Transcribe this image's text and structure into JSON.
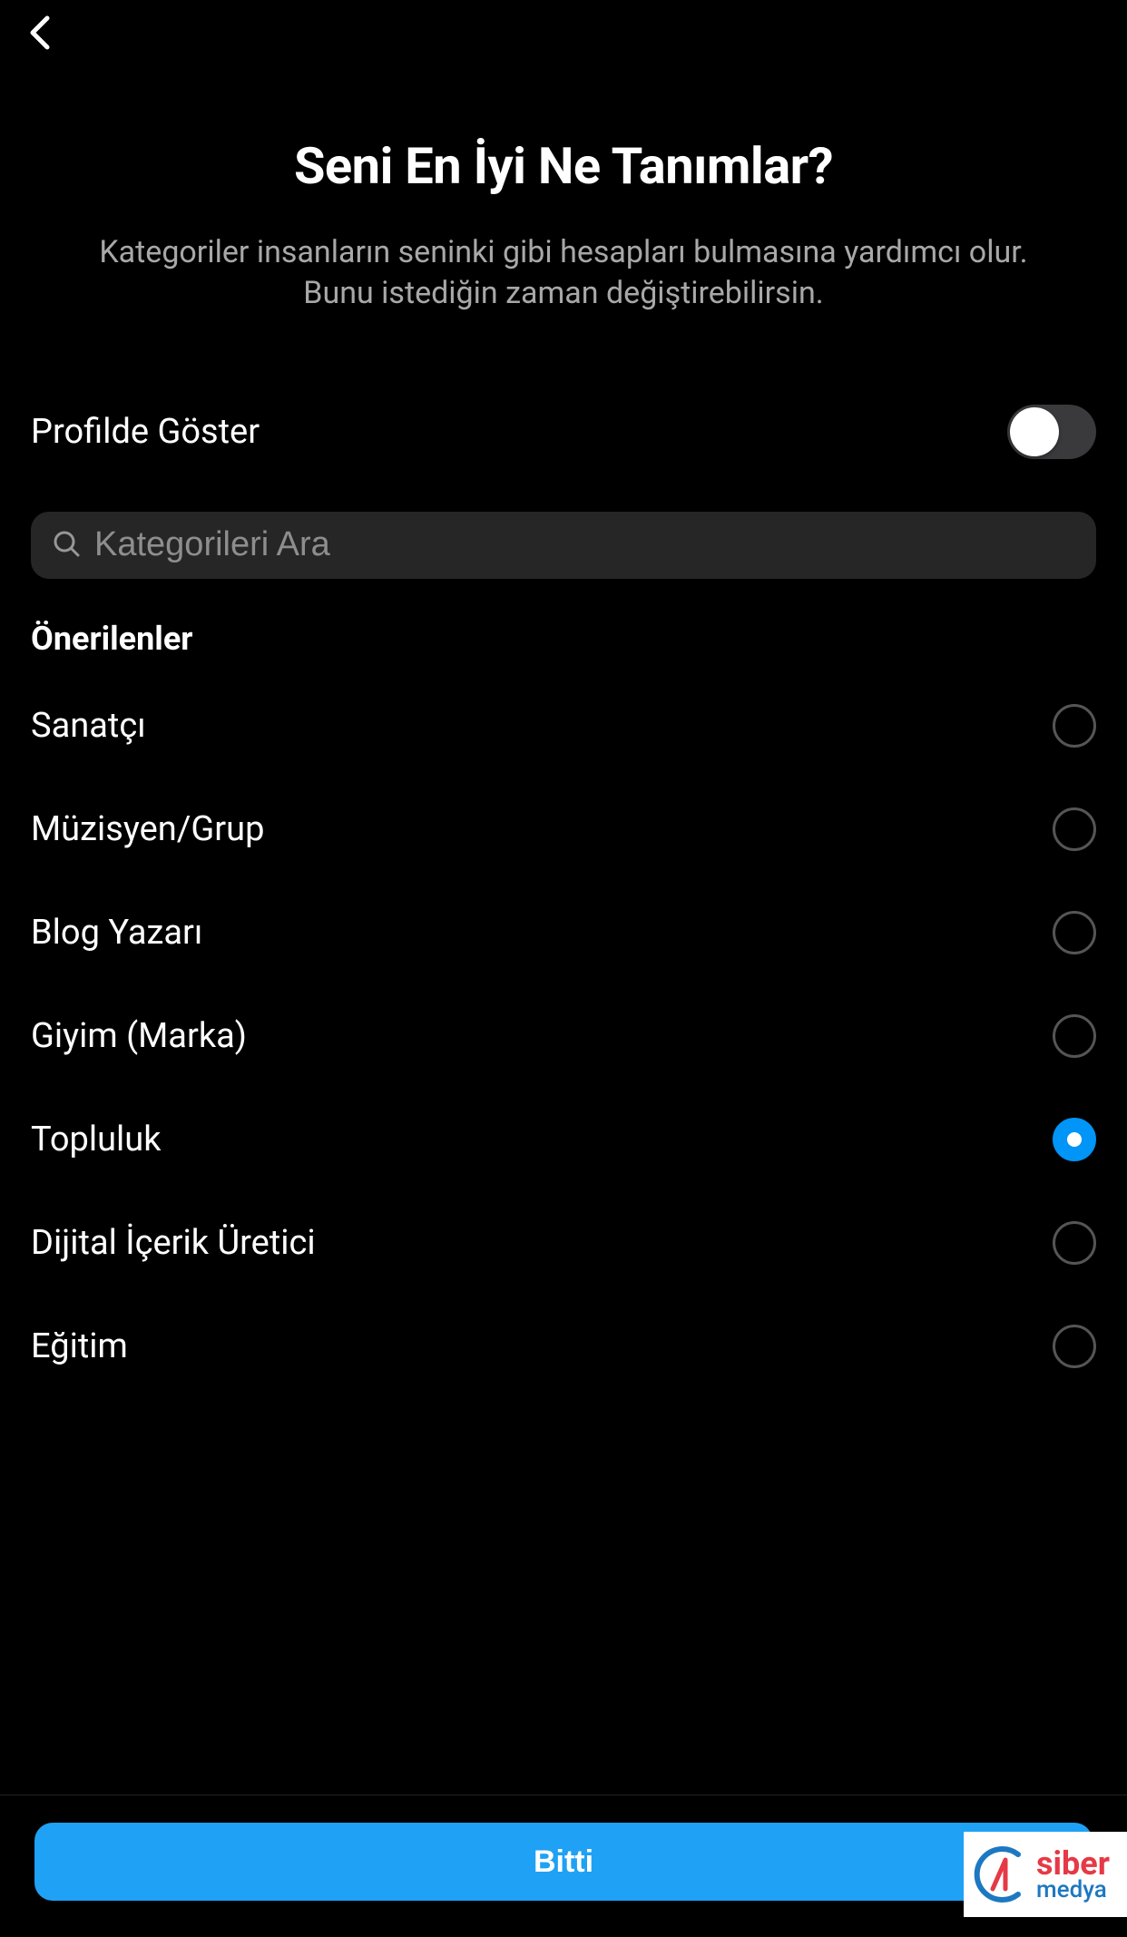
{
  "header": {
    "title": "Seni En İyi Ne Tanımlar?",
    "subtitle": "Kategoriler insanların seninki gibi hesapları bulmasına yardımcı olur. Bunu istediğin zaman değiştirebilirsin."
  },
  "toggle": {
    "label": "Profilde Göster",
    "enabled": false
  },
  "search": {
    "placeholder": "Kategorileri Ara"
  },
  "section": {
    "heading": "Önerilenler"
  },
  "categories": [
    {
      "label": "Sanatçı",
      "selected": false
    },
    {
      "label": "Müzisyen/Grup",
      "selected": false
    },
    {
      "label": "Blog Yazarı",
      "selected": false
    },
    {
      "label": "Giyim (Marka)",
      "selected": false
    },
    {
      "label": "Topluluk",
      "selected": true
    },
    {
      "label": "Dijital İçerik Üretici",
      "selected": false
    },
    {
      "label": "Eğitim",
      "selected": false
    }
  ],
  "footer": {
    "done_label": "Bitti"
  },
  "watermark": {
    "line1": "siber",
    "line2": "medya"
  }
}
